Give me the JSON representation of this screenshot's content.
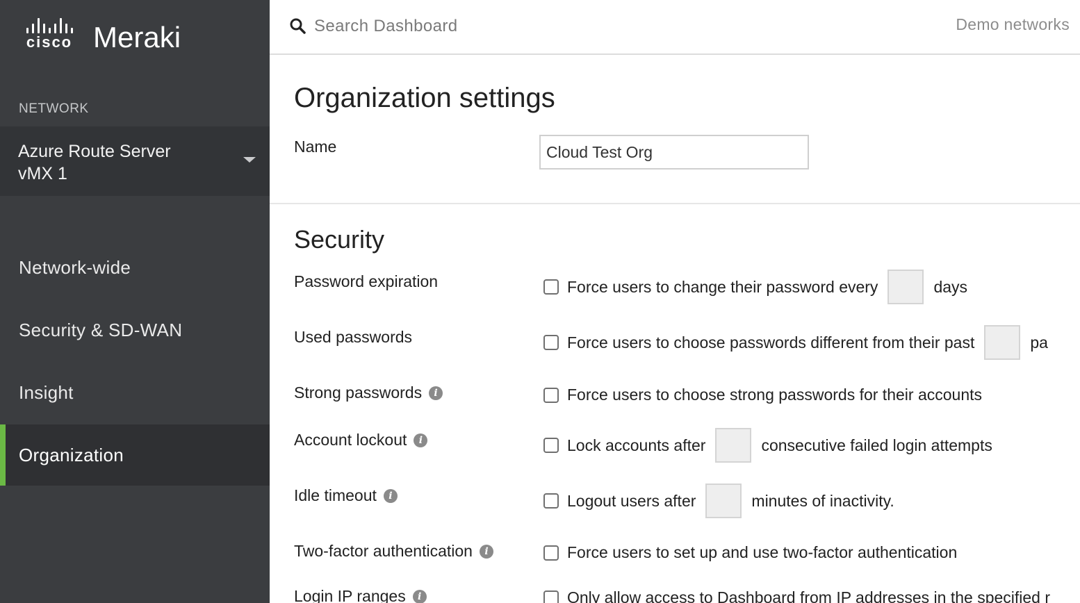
{
  "sidebar": {
    "logo": {
      "cisco": "cisco",
      "meraki": "Meraki"
    },
    "section_label": "NETWORK",
    "network": {
      "line1": "Azure Route Server",
      "line2": "vMX 1"
    },
    "nav": [
      {
        "label": "Network-wide"
      },
      {
        "label": "Security & SD-WAN"
      },
      {
        "label": "Insight"
      },
      {
        "label": "Organization",
        "active": true
      }
    ],
    "accent_color": "#6bb945"
  },
  "topbar": {
    "search_placeholder": "Search Dashboard",
    "search_value": "",
    "demo_link": "Demo networks"
  },
  "main": {
    "page_title": "Organization settings",
    "name_label": "Name",
    "name_value": "Cloud Test Org",
    "security_title": "Security",
    "settings": [
      {
        "label": "Password expiration",
        "info": false,
        "before": "Force users to change their password every",
        "input": "",
        "after": "days",
        "checked": false
      },
      {
        "label": "Used passwords",
        "info": false,
        "before": "Force users to choose passwords different from their past",
        "input": "",
        "after": "pa",
        "checked": false
      },
      {
        "label": "Strong passwords",
        "info": true,
        "before": "Force users to choose strong passwords for their accounts",
        "checked": false
      },
      {
        "label": "Account lockout",
        "info": true,
        "before": "Lock accounts after",
        "input": "",
        "after": "consecutive failed login attempts",
        "checked": false
      },
      {
        "label": "Idle timeout",
        "info": true,
        "before": "Logout users after",
        "input": "",
        "after": "minutes of inactivity.",
        "checked": false
      },
      {
        "label": "Two-factor authentication",
        "info": true,
        "before": "Force users to set up and use two-factor authentication",
        "checked": false
      },
      {
        "label": "Login IP ranges",
        "info": true,
        "before": "Only allow access to Dashboard from IP addresses in the specified r",
        "checked": false
      }
    ]
  }
}
